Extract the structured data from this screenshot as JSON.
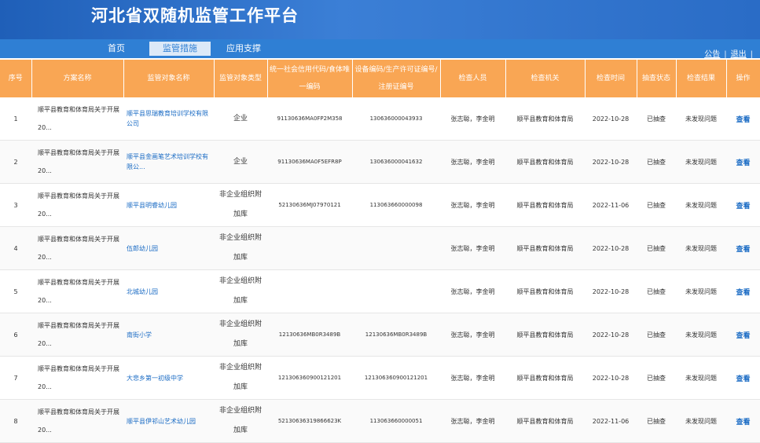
{
  "header": {
    "title": "河北省双随机监管工作平台"
  },
  "nav": {
    "tabs": [
      "首页",
      "监管措施",
      "应用支撑"
    ],
    "active_index": 1,
    "links": [
      "公告",
      "退出"
    ]
  },
  "table": {
    "headers": [
      "序号",
      "方案名称",
      "监管对象名称",
      "监管对象类型",
      "统一社会信用代码/食体唯一编码",
      "设备编码/生产许可证编号/注册证编号",
      "检查人员",
      "检查机关",
      "检查时间",
      "抽查状态",
      "检查结果",
      "操作"
    ],
    "rows": [
      {
        "no": "1",
        "plan1": "顺平县教育和体育局关于开展",
        "plan2": "20...",
        "target": "顺平县思瑞教育培训学校有限公司",
        "type": "企业",
        "credit": "91130636MA0FP2M358",
        "cert": "130636000043933",
        "inspectors": "张志聪，李金明",
        "agency": "顺平县教育和体育局",
        "date": "2022-10-28",
        "status": "已抽查",
        "result": "未发现问题",
        "action": "查看"
      },
      {
        "no": "2",
        "plan1": "顺平县教育和体育局关于开展",
        "plan2": "20...",
        "target": "顺平县金画笔艺术培训学校有限公...",
        "type": "企业",
        "credit": "91130636MA0F5EFR8P",
        "cert": "130636000041632",
        "inspectors": "张志聪，李金明",
        "agency": "顺平县教育和体育局",
        "date": "2022-10-28",
        "status": "已抽查",
        "result": "未发现问题",
        "action": "查看"
      },
      {
        "no": "3",
        "plan1": "顺平县教育和体育局关于开展",
        "plan2": "20...",
        "target": "顺平县明睿幼儿园",
        "type": "非企业组织附加库",
        "credit": "52130636MJ07970121",
        "cert": "113063660000098",
        "inspectors": "张志聪，李金明",
        "agency": "顺平县教育和体育局",
        "date": "2022-11-06",
        "status": "已抽查",
        "result": "未发现问题",
        "action": "查看"
      },
      {
        "no": "4",
        "plan1": "顺平县教育和体育局关于开展",
        "plan2": "20...",
        "target": "伍郎幼儿园",
        "type": "非企业组织附加库",
        "credit": "",
        "cert": "",
        "inspectors": "张志聪，李金明",
        "agency": "顺平县教育和体育局",
        "date": "2022-10-28",
        "status": "已抽查",
        "result": "未发现问题",
        "action": "查看"
      },
      {
        "no": "5",
        "plan1": "顺平县教育和体育局关于开展",
        "plan2": "20...",
        "target": "北城幼儿园",
        "type": "非企业组织附加库",
        "credit": "",
        "cert": "",
        "inspectors": "张志聪，李金明",
        "agency": "顺平县教育和体育局",
        "date": "2022-10-28",
        "status": "已抽查",
        "result": "未发现问题",
        "action": "查看"
      },
      {
        "no": "6",
        "plan1": "顺平县教育和体育局关于开展",
        "plan2": "20...",
        "target": "南街小学",
        "type": "非企业组织附加库",
        "credit": "12130636MB0R3489B",
        "cert": "12130636MB0R3489B",
        "inspectors": "张志聪，李金明",
        "agency": "顺平县教育和体育局",
        "date": "2022-10-28",
        "status": "已抽查",
        "result": "未发现问题",
        "action": "查看"
      },
      {
        "no": "7",
        "plan1": "顺平县教育和体育局关于开展",
        "plan2": "20...",
        "target": "大悲乡第一初级中学",
        "type": "非企业组织附加库",
        "credit": "121306360900121201",
        "cert": "121306360900121201",
        "inspectors": "张志聪，李金明",
        "agency": "顺平县教育和体育局",
        "date": "2022-10-28",
        "status": "已抽查",
        "result": "未发现问题",
        "action": "查看"
      },
      {
        "no": "8",
        "plan1": "顺平县教育和体育局关于开展",
        "plan2": "20...",
        "target": "顺平县伊祁山艺术幼儿园",
        "type": "非企业组织附加库",
        "credit": "52130636319866623K",
        "cert": "113063660000051",
        "inspectors": "张志聪，李金明",
        "agency": "顺平县教育和体育局",
        "date": "2022-11-06",
        "status": "已抽查",
        "result": "未发现问题",
        "action": "查看"
      }
    ]
  },
  "colors": {
    "header": "#2a6cc6",
    "nav": "#2f7fd4",
    "table_header": "#f9a654",
    "link": "#1a6bc4"
  }
}
